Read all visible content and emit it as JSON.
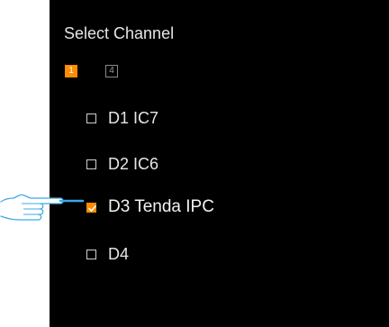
{
  "panel": {
    "title": "Select Channel"
  },
  "layouts": [
    {
      "label": "1",
      "active": true
    },
    {
      "label": "4",
      "active": false
    }
  ],
  "channels": [
    {
      "label": "D1 IC7",
      "checked": false
    },
    {
      "label": "D2 IC6",
      "checked": false
    },
    {
      "label": "D3 Tenda IPC",
      "checked": true
    },
    {
      "label": "D4",
      "checked": false
    }
  ],
  "colors": {
    "accent": "#ff8c00",
    "panel_bg": "#000000",
    "text": "#e6e6e6",
    "pointer": "#3ea8e6"
  },
  "icons": {
    "pointer": "pointing-hand-icon",
    "check": "checkmark-icon"
  }
}
